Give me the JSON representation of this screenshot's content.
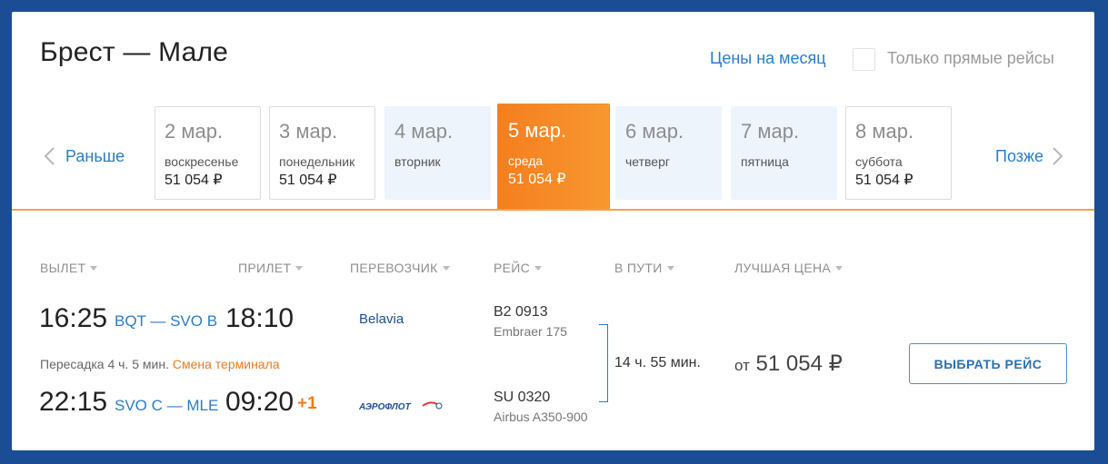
{
  "header": {
    "route": "Брест — Мале",
    "month_prices_link": "Цены на месяц",
    "direct_only_label": "Только прямые рейсы"
  },
  "date_nav": {
    "earlier_label": "Раньше",
    "later_label": "Позже",
    "days": [
      {
        "date": "2 мар.",
        "weekday": "воскресенье",
        "price": "51 054 ₽"
      },
      {
        "date": "3 мар.",
        "weekday": "понедельник",
        "price": "51 054 ₽"
      },
      {
        "date": "4 мар.",
        "weekday": "вторник",
        "price": ""
      },
      {
        "date": "5 мар.",
        "weekday": "среда",
        "price": "51 054 ₽"
      },
      {
        "date": "6 мар.",
        "weekday": "четверг",
        "price": ""
      },
      {
        "date": "7 мар.",
        "weekday": "пятница",
        "price": ""
      },
      {
        "date": "8 мар.",
        "weekday": "суббота",
        "price": "51 054 ₽"
      }
    ],
    "selected_index": 3
  },
  "columns": {
    "departure": "ВЫЛЕТ",
    "arrival": "ПРИЛЕТ",
    "carrier": "ПЕРЕВОЗЧИК",
    "flight": "РЕЙС",
    "duration": "В ПУТИ",
    "best_price": "ЛУЧШАЯ ЦЕНА"
  },
  "result": {
    "segments": [
      {
        "dep_time": "16:25",
        "airports": "BQT — SVO B",
        "arr_time": "18:10",
        "plus_day": "",
        "carrier": "Belavia",
        "flight_no": "B2 0913",
        "aircraft": "Embraer 175"
      },
      {
        "dep_time": "22:15",
        "airports": "SVO C — MLE",
        "arr_time": "09:20",
        "plus_day": "+1",
        "carrier": "АЭРОФЛОТ",
        "flight_no": "SU 0320",
        "aircraft": "Airbus A350-900"
      }
    ],
    "transfer_text": "Пересадка 4 ч. 5 мин.",
    "terminal_change": "Смена терминала",
    "duration": "14 ч. 55 мин.",
    "price_prefix": "от",
    "price": "51 054 ₽",
    "select_button": "ВЫБРАТЬ РЕЙС"
  },
  "colors": {
    "background": "#1a4d94",
    "accent_blue": "#2a7cc7",
    "accent_orange": "#f57e1f"
  }
}
